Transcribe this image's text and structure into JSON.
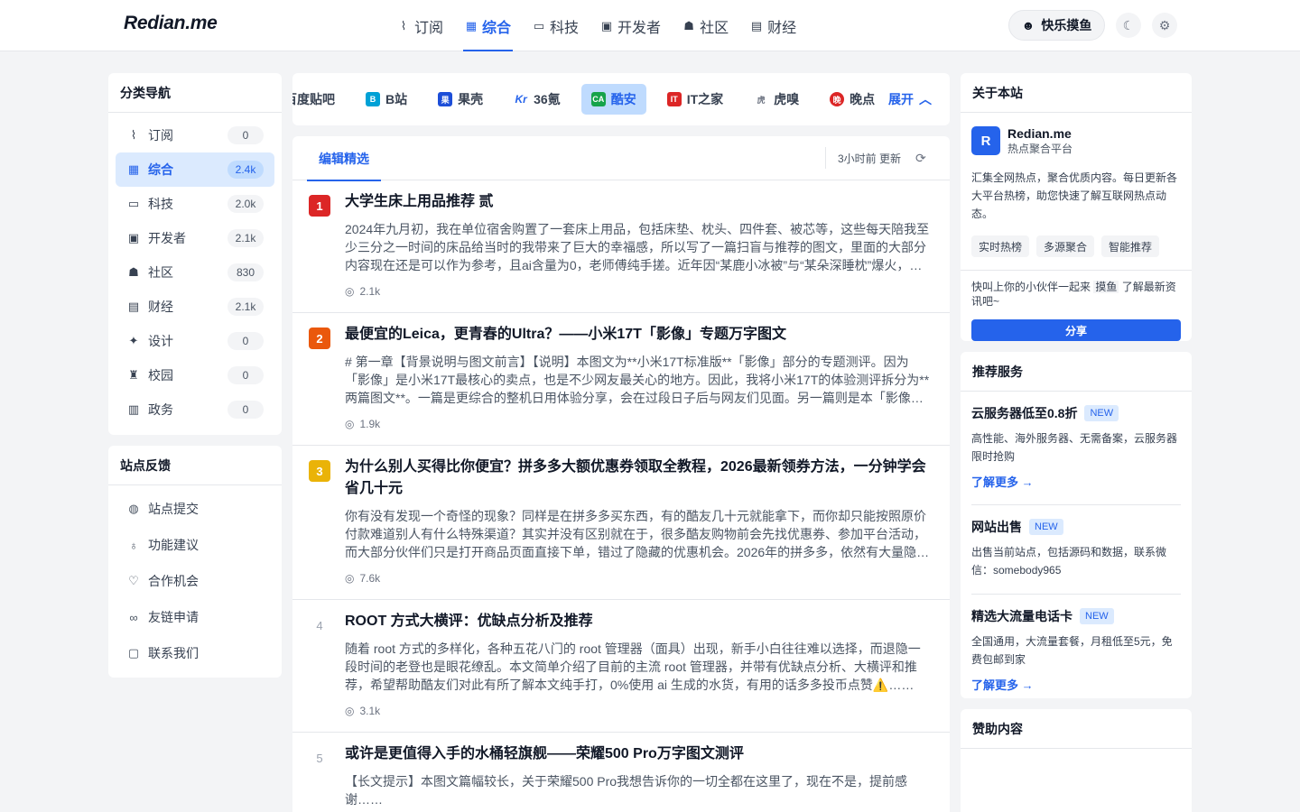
{
  "header": {
    "logo": "Redian.me",
    "nav": [
      {
        "label": "订阅",
        "icon": "rss-icon"
      },
      {
        "label": "综合",
        "icon": "grid-icon",
        "active": true
      },
      {
        "label": "科技",
        "icon": "monitor-icon"
      },
      {
        "label": "开发者",
        "icon": "terminal-icon"
      },
      {
        "label": "社区",
        "icon": "users-icon"
      },
      {
        "label": "财经",
        "icon": "money-icon"
      }
    ],
    "mood_label": "快乐摸鱼",
    "theme_icon": "moon-icon",
    "settings_icon": "gear-icon"
  },
  "sidebar": {
    "categories_title": "分类导航",
    "categories": [
      {
        "label": "订阅",
        "count": "0",
        "icon": "rss-icon"
      },
      {
        "label": "综合",
        "count": "2.4k",
        "icon": "grid-icon",
        "active": true
      },
      {
        "label": "科技",
        "count": "2.0k",
        "icon": "monitor-icon"
      },
      {
        "label": "开发者",
        "count": "2.1k",
        "icon": "terminal-icon"
      },
      {
        "label": "社区",
        "count": "830",
        "icon": "users-icon"
      },
      {
        "label": "财经",
        "count": "2.1k",
        "icon": "money-icon"
      },
      {
        "label": "设计",
        "count": "0",
        "icon": "sparkle-icon"
      },
      {
        "label": "校园",
        "count": "0",
        "icon": "graduation-cap-icon"
      },
      {
        "label": "政务",
        "count": "0",
        "icon": "building-icon"
      }
    ],
    "feedback_title": "站点反馈",
    "feedback": [
      {
        "label": "站点提交",
        "icon": "globe-icon"
      },
      {
        "label": "功能建议",
        "icon": "lightbulb-icon"
      },
      {
        "label": "合作机会",
        "icon": "handshake-icon"
      },
      {
        "label": "友链申请",
        "icon": "link-icon"
      },
      {
        "label": "联系我们",
        "icon": "contact-icon"
      }
    ]
  },
  "sources": {
    "items": [
      {
        "label": "百度贴吧",
        "color": "#3b82f6",
        "glyph": ""
      },
      {
        "label": "B站",
        "color": "#00a1d6",
        "glyph": "B"
      },
      {
        "label": "果壳",
        "color": "#1d4ed8",
        "glyph": "果"
      },
      {
        "label": "36氪",
        "color": "#2563eb",
        "glyph": "Kr"
      },
      {
        "label": "酷安",
        "color": "#16a34a",
        "glyph": "CA",
        "active": true
      },
      {
        "label": "IT之家",
        "color": "#dc2626",
        "glyph": "IT"
      },
      {
        "label": "虎嗅",
        "color": "#6b7280",
        "glyph": "虎"
      },
      {
        "label": "晚点",
        "color": "#dc2626",
        "glyph": "晚"
      }
    ],
    "expand_label": "展开"
  },
  "feed": {
    "tab": "编辑精选",
    "updated": "3小时前 更新",
    "items": [
      {
        "rank": "1",
        "rank_color": "#dc2626",
        "title": "大学生床上用品推荐 贰",
        "desc": "2024年九月初，我在单位宿舍购置了一套床上用品，包括床垫、枕头、四件套、被芯等，这些每天陪我至少三分之一时间的床品给当时的我带来了巨大的幸福感，所以写了一篇扫盲与推荐的图文，里面的大部分内容现在还是可以作为参考，且ai含量为0，老师傅纯手搓。近年因“某鹿小冰被”与“某朵深睡枕”爆火，床品话题热度不减……",
        "views": "2.1k"
      },
      {
        "rank": "2",
        "rank_color": "#ea580c",
        "title": "最便宜的Leica，更青春的Ultra？——小米17T「影像」专题万字图文",
        "desc": "# 第一章【背景说明与图文前言】【说明】本图文为**小米17T标准版**「影像」部分的专题测评。因为「影像」是小米17T最核心的卖点，也是不少网友最关心的地方。因此，我将小米17T的体验测评拆分为**两篇图文**。一篇是更综合的整机日用体验分享，会在过段日子后与网友们见面。另一篇则是本「影像」专题……",
        "views": "1.9k"
      },
      {
        "rank": "3",
        "rank_color": "#eab308",
        "title": "为什么别人买得比你便宜？拼多多大额优惠券领取全教程，2026最新领券方法，一分钟学会省几十元",
        "desc": "你有没有发现一个奇怪的现象？同样是在拼多多买东西，有的酷友几十元就能拿下，而你却只能按照原价付款难道别人有什么特殊渠道？其实并没有区别就在于，很多酷友购物前会先找优惠券、参加平台活动，而大部分伙伴们只是打开商品页面直接下单，错过了隐藏的优惠机会。2026年的拼多多，依然有大量隐藏优惠……",
        "views": "7.6k"
      },
      {
        "rank": "4",
        "rank_color": "",
        "title": "ROOT 方式大横评：优缺点分析及推荐",
        "desc": "随着 root 方式的多样化，各种五花八门的 root 管理器（面具）出现，新手小白往往难以选择，而退隐一段时间的老登也是眼花缭乱。本文简单介绍了目前的主流 root 管理器，并带有优缺点分析、大横评和推荐，希望帮助酷友们对此有所了解本文纯手打，0%使用 ai 生成的水货，有用的话多多投币点赞⚠️……",
        "views": "3.1k"
      },
      {
        "rank": "5",
        "rank_color": "",
        "title": "或许是更值得入手的水桶轻旗舰——荣耀500 Pro万字图文测评",
        "desc": "【长文提示】本图文篇幅较长，关于荣耀500 Pro我想告诉你的一切全都在这里了，现在不是，提前感谢……",
        "views": ""
      }
    ]
  },
  "about": {
    "title": "关于本站",
    "brand_avatar": "R",
    "brand_name": "Redian.me",
    "brand_sub": "热点聚合平台",
    "desc": "汇集全网热点，聚合优质内容。每日更新各大平台热榜，助您快速了解互联网热点动态。",
    "tags": [
      "实时热榜",
      "多源聚合",
      "智能推荐"
    ],
    "invite_pre": "快叫上你的小伙伴一起来",
    "invite_key": "摸鱼",
    "invite_post": "了解最新资讯吧~",
    "share_label": "分享"
  },
  "services": {
    "title": "推荐服务",
    "new_label": "NEW",
    "items": [
      {
        "title": "云服务器低至0.8折",
        "desc": "高性能、海外服务器、无需备案，云服务器限时抢购",
        "link": "了解更多 →"
      },
      {
        "title": "网站出售",
        "desc": "出售当前站点，包括源码和数据，联系微信：somebody965",
        "link": ""
      },
      {
        "title": "精选大流量电话卡",
        "desc": "全国通用，大流量套餐，月租低至5元，免费包邮到家",
        "link": "了解更多 →"
      }
    ]
  },
  "sponsor": {
    "title": "赞助内容"
  }
}
